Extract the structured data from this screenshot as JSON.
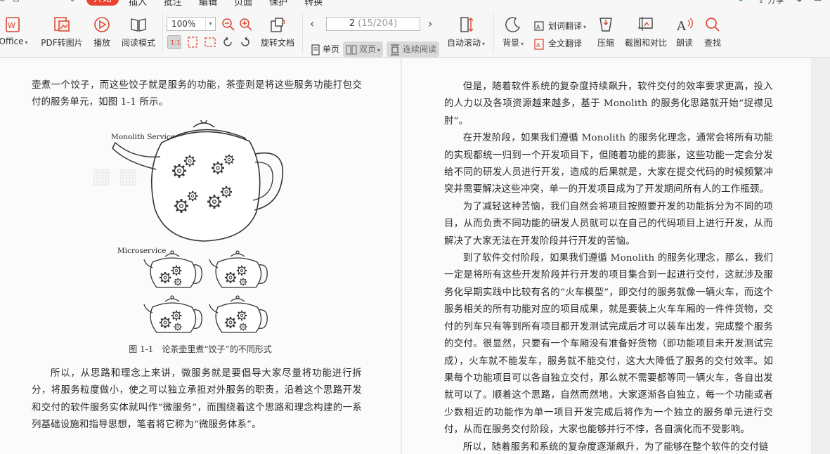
{
  "menubar": {
    "tabs": [
      "开始",
      "插入",
      "批注",
      "编辑",
      "页面",
      "保护",
      "转换"
    ],
    "active_tab": "开始",
    "share_label": "分享"
  },
  "toolbar": {
    "office_label": "Office",
    "pdf_to_image_label": "PDF转图片",
    "play_label": "播放",
    "read_mode_label": "阅读模式",
    "zoom_value": "100%",
    "rotate_label": "旋转文档",
    "page_current": "2",
    "page_total": "(15/204)",
    "single_page_label": "单页",
    "double_page_label": "双页",
    "continuous_label": "连续阅读",
    "auto_scroll_label": "自动滚动",
    "background_label": "背景",
    "word_translate_label": "划词翻译",
    "full_translate_label": "全文翻译",
    "compress_label": "压缩",
    "screenshot_compare_label": "截图和对比",
    "read_aloud_label": "朗读",
    "find_label": "查找"
  },
  "left_page": {
    "top_paragraph": "壶煮一个饺子，而这些饺子就是服务的功能，茶壶则是将这些服务功能打包交付的服务单元，如图 1-1 所示。",
    "figure": {
      "monolith_label": "Monolith Service",
      "micro_label": "Microservice",
      "caption": "图 1-1　论茶壶里煮“饺子”的不同形式"
    },
    "bottom_paragraph": "所以，从思路和理念上来讲，微服务就是要倡导大家尽量将功能进行拆分，将服务粒度做小，使之可以独立承担对外服务的职责，沿着这个思路开发和交付的软件服务实体就叫作“微服务”，而围绕着这个思路和理念构建的一系列基础设施和指导思想，笔者将它称为“微服务体系”。"
  },
  "right_page": {
    "paragraphs": [
      "但是，随着软件系统的复杂度持续飙升，软件交付的效率要求更高，投入的人力以及各项资源越来越多，基于 Monolith 的服务化思路就开始“捉襟见肘”。",
      "在开发阶段，如果我们遵循 Monolith 的服务化理念，通常会将所有功能的实现都统一归到一个开发项目下，但随着功能的膨胀，这些功能一定会分发给不同的研发人员进行开发，造成的后果就是，大家在提交代码的时候频繁冲突并需要解决这些冲突，单一的开发项目成为了开发期间所有人的工作瓶颈。",
      "为了减轻这种苦恼，我们自然会将项目按照要开发的功能拆分为不同的项目，从而负责不同功能的研发人员就可以在自己的代码项目上进行开发，从而解决了大家无法在开发阶段并行开发的苦恼。",
      "到了软件交付阶段，如果我们遵循 Monolith 的服务化理念，那么，我们一定是将所有这些开发阶段并行开发的项目集合到一起进行交付，这就涉及服务化早期实践中比较有名的“火车模型”，即交付的服务就像一辆火车，而这个服务相关的所有功能对应的项目成果，就是要装上火车车厢的一件件货物，交付的列车只有等到所有项目都开发测试完成后才可以装车出发，完成整个服务的交付。很显然，只要有一个车厢没有准备好货物（即功能项目未开发测试完成），火车就不能发车，服务就不能交付，这大大降低了服务的交付效率。如果每个功能项目可以各自独立交付，那么就不需要都等同一辆火车，各自出发就可以了。顺着这个思路，自然而然地，大家逐渐各自独立，每一个功能或者少数相近的功能作为单一项目开发完成后将作为一个独立的服务单元进行交付，从而在服务交付阶段，大家也能够并行不悖，各自演化而不受影响。",
      "所以，随着服务和系统的复杂度逐渐飙升，为了能够在整个软件的交付链"
    ]
  },
  "colors": {
    "accent": "#e8432e",
    "toolbar_bg": "#f7f7f7",
    "page_bg": "#fbfbfb"
  }
}
